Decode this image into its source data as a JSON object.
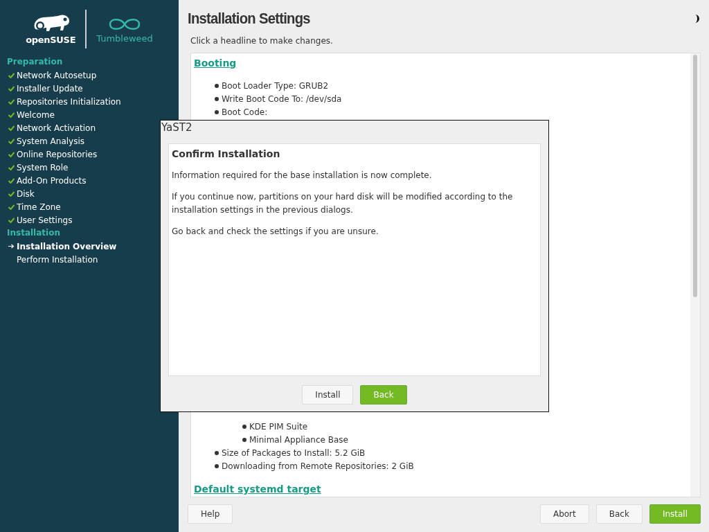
{
  "logo": {
    "brand": "openSUSE",
    "product": "Tumbleweed"
  },
  "sidebar": {
    "sections": [
      {
        "title": "Preparation",
        "items": [
          {
            "label": "Network Autosetup",
            "checked": true,
            "current": false
          },
          {
            "label": "Installer Update",
            "checked": true,
            "current": false
          },
          {
            "label": "Repositories Initialization",
            "checked": true,
            "current": false
          },
          {
            "label": "Welcome",
            "checked": true,
            "current": false
          },
          {
            "label": "Network Activation",
            "checked": true,
            "current": false
          },
          {
            "label": "System Analysis",
            "checked": true,
            "current": false
          },
          {
            "label": "Online Repositories",
            "checked": true,
            "current": false
          },
          {
            "label": "System Role",
            "checked": true,
            "current": false
          },
          {
            "label": "Add-On Products",
            "checked": true,
            "current": false
          },
          {
            "label": "Disk",
            "checked": true,
            "current": false
          },
          {
            "label": "Time Zone",
            "checked": true,
            "current": false
          },
          {
            "label": "User Settings",
            "checked": true,
            "current": false
          }
        ]
      },
      {
        "title": "Installation",
        "items": [
          {
            "label": "Installation Overview",
            "checked": false,
            "current": true
          },
          {
            "label": "Perform Installation",
            "checked": false,
            "current": false
          }
        ]
      }
    ]
  },
  "page": {
    "title": "Installation Settings",
    "hint": "Click a headline to make changes."
  },
  "overview_top": [
    {
      "heading": "Booting",
      "items": [
        {
          "text": "Boot Loader Type: GRUB2"
        },
        {
          "text": "Write Boot Code To: /dev/sda"
        },
        {
          "text": "Boot Code:"
        }
      ]
    }
  ],
  "overview_bottom": {
    "items": [
      {
        "text": "KDE PIM Suite",
        "level2": true
      },
      {
        "text": "Minimal Appliance Base",
        "level2": true
      },
      {
        "text": "Size of Packages to Install: 5.2 GiB",
        "level2": false
      },
      {
        "text": "Downloading from Remote Repositories: 2 GiB",
        "level2": false
      }
    ],
    "heading": "Default systemd target"
  },
  "dialog": {
    "window_title": "YaST2",
    "heading": "Confirm Installation",
    "paragraphs": [
      "Information required for the base installation is now complete.",
      "If you continue now, partitions on your hard disk will be modified according to the installation settings in the previous dialogs.",
      "Go back and check the settings if you are unsure."
    ],
    "buttons": [
      {
        "label": "Install",
        "primary": false
      },
      {
        "label": "Back",
        "primary": true
      }
    ]
  },
  "footer": {
    "left": [
      {
        "label": "Help",
        "primary": false
      }
    ],
    "right": [
      {
        "label": "Abort",
        "primary": false
      },
      {
        "label": "Back",
        "primary": false
      },
      {
        "label": "Install",
        "primary": true
      }
    ]
  }
}
